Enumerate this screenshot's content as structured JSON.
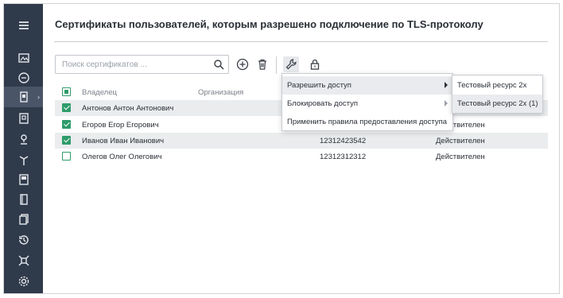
{
  "page": {
    "title": "Сертификаты пользователей, которым разрешено подключение по TLS-протоколу"
  },
  "search": {
    "placeholder": "Поиск сертификатов ..."
  },
  "table": {
    "headers": {
      "owner": "Владелец",
      "org": "Организация"
    },
    "rows": [
      {
        "owner": "Антонов Антон Антонович",
        "serial": "",
        "status": "",
        "checked": true
      },
      {
        "owner": "Егоров Егор Егорович",
        "serial": "",
        "status": "Действителен",
        "checked": true
      },
      {
        "owner": "Иванов Иван Иванович",
        "serial": "12312423542",
        "status": "Действителен",
        "checked": true
      },
      {
        "owner": "Олегов Олег Олегович",
        "serial": "12312312312",
        "status": "Действителен",
        "checked": false
      }
    ]
  },
  "menu": {
    "items": [
      "Разрешить доступ",
      "Блокировать доступ",
      "Применить правила предоставления доступа"
    ]
  },
  "submenu": {
    "items": [
      "Тестовый ресурс 2х",
      "Тестовый ресурс 2х (1)"
    ]
  },
  "colors": {
    "sidebar": "#2f3a4b",
    "accent": "#2e9c6a"
  },
  "icons": {
    "sidebar": [
      "menu-icon",
      "image-icon",
      "chat-icon",
      "badge-icon",
      "certificate-icon",
      "user-pin-icon",
      "antenna-icon",
      "id-card-icon",
      "document-icon",
      "copy-icon",
      "history-icon",
      "network-icon",
      "settings-icon"
    ],
    "toolbar": [
      "search-icon",
      "add-icon",
      "delete-icon",
      "wrench-icon",
      "lock-icon"
    ]
  }
}
